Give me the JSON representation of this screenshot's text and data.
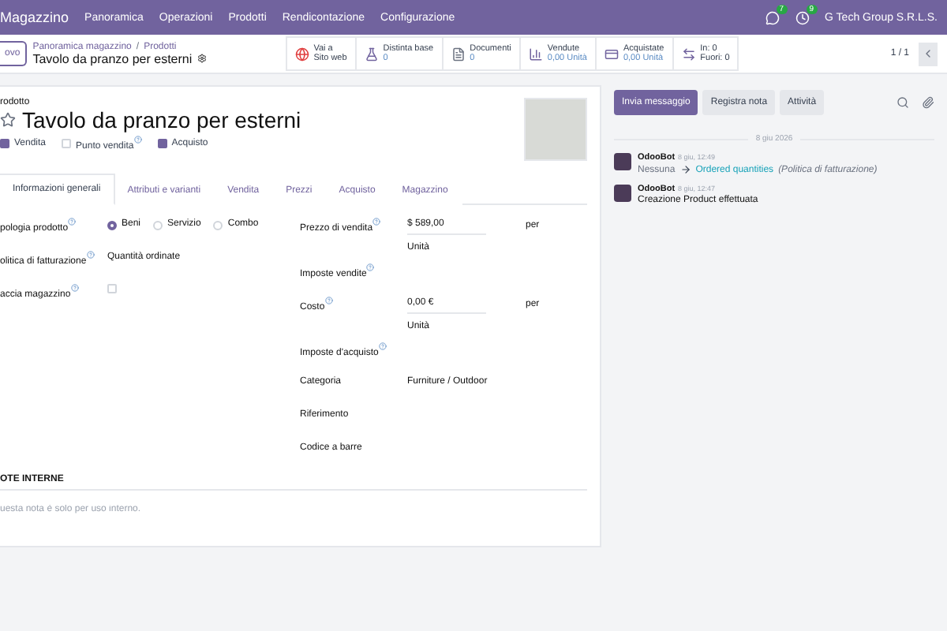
{
  "navbar": {
    "app": "Magazzino",
    "menu": [
      "Panoramica",
      "Operazioni",
      "Prodotti",
      "Rendicontazione",
      "Configurazione"
    ],
    "messages_badge": "7",
    "activity_badge": "9",
    "company": "G Tech Group S.R.L.S."
  },
  "control_panel": {
    "new_button": "ovo",
    "breadcrumb": [
      "Panoramica magazzino",
      "Prodotti"
    ],
    "breadcrumb_separator": "/",
    "record_title": "Tavolo da pranzo per esterni",
    "pager": "1 / 1",
    "stat_buttons": [
      {
        "kind": "website",
        "label": "Vai a",
        "value": "Sito web"
      },
      {
        "kind": "bom",
        "label": "Distinta base",
        "value": "0"
      },
      {
        "kind": "documents",
        "label": "Documenti",
        "value": "0"
      },
      {
        "kind": "sold",
        "label": "Vendute",
        "value": "0,00 Unità"
      },
      {
        "kind": "purchased",
        "label": "Acquistate",
        "value": "0,00 Unità"
      },
      {
        "kind": "inout",
        "label": "In: 0",
        "value": "Fuori: 0"
      }
    ]
  },
  "form": {
    "caption": "rodotto",
    "name": "Tavolo da pranzo per esterni",
    "favorite": false,
    "options": [
      {
        "label": "Vendita",
        "checked": true,
        "help": false
      },
      {
        "label": "Punto vendita",
        "checked": false,
        "help": true
      },
      {
        "label": "Acquisto",
        "checked": true,
        "help": false
      }
    ],
    "tabs": [
      {
        "label": "Informazioni generali",
        "selected": true
      },
      {
        "label": "Attributi e varianti",
        "selected": false
      },
      {
        "label": "Vendita",
        "selected": false
      },
      {
        "label": "Prezzi",
        "selected": false
      },
      {
        "label": "Acquisto",
        "selected": false
      },
      {
        "label": "Magazzino",
        "selected": false
      }
    ],
    "left_fields": [
      {
        "kind": "radio",
        "label": "pologia prodotto",
        "help": true,
        "choices": [
          {
            "label": "Beni",
            "selected": true
          },
          {
            "label": "Servizio",
            "selected": false
          },
          {
            "label": "Combo",
            "selected": false
          }
        ]
      },
      {
        "kind": "text",
        "label": "olitica di fatturazione",
        "help": true,
        "value": "Quantità ordinate"
      },
      {
        "kind": "checkbox",
        "label": "accia magazzino",
        "help": true,
        "checked": false
      }
    ],
    "right_fields": [
      {
        "kind": "price",
        "label": "Prezzo di vendita",
        "help": true,
        "value": "$ 589,00",
        "per": "per",
        "unit": "Unità"
      },
      {
        "kind": "text",
        "label": "Imposte vendite",
        "help": true
      },
      {
        "kind": "price",
        "label": "Costo",
        "help": true,
        "value": "0,00 €",
        "per": "per",
        "unit": "Unità"
      },
      {
        "kind": "text",
        "label": "Imposte d'acquisto",
        "help": true
      },
      {
        "kind": "text",
        "label": "Categoria",
        "help": false,
        "value": "Furniture / Outdoor"
      },
      {
        "kind": "text",
        "label": "Riferimento",
        "help": false
      },
      {
        "kind": "text",
        "label": "Codice a barre",
        "help": false
      }
    ],
    "notes_title": "OTE INTERNE",
    "notes_placeholder": "uesta nota è solo per uso interno."
  },
  "chatter": {
    "buttons": [
      {
        "label": "Invia messaggio",
        "selected": true
      },
      {
        "label": "Registra nota",
        "selected": false
      },
      {
        "label": "Attività",
        "selected": false
      }
    ],
    "date": "8 giu 2026",
    "messages": [
      {
        "kind": "tracking",
        "author": "OdooBot",
        "time": "8 giu, 12:49",
        "old": "Nessuna",
        "new": "Ordered quantities",
        "field": "(Politica di fatturazione)"
      },
      {
        "kind": "text",
        "author": "OdooBot",
        "time": "8 giu, 12:47",
        "body": "Creazione Product effettuata"
      }
    ]
  }
}
